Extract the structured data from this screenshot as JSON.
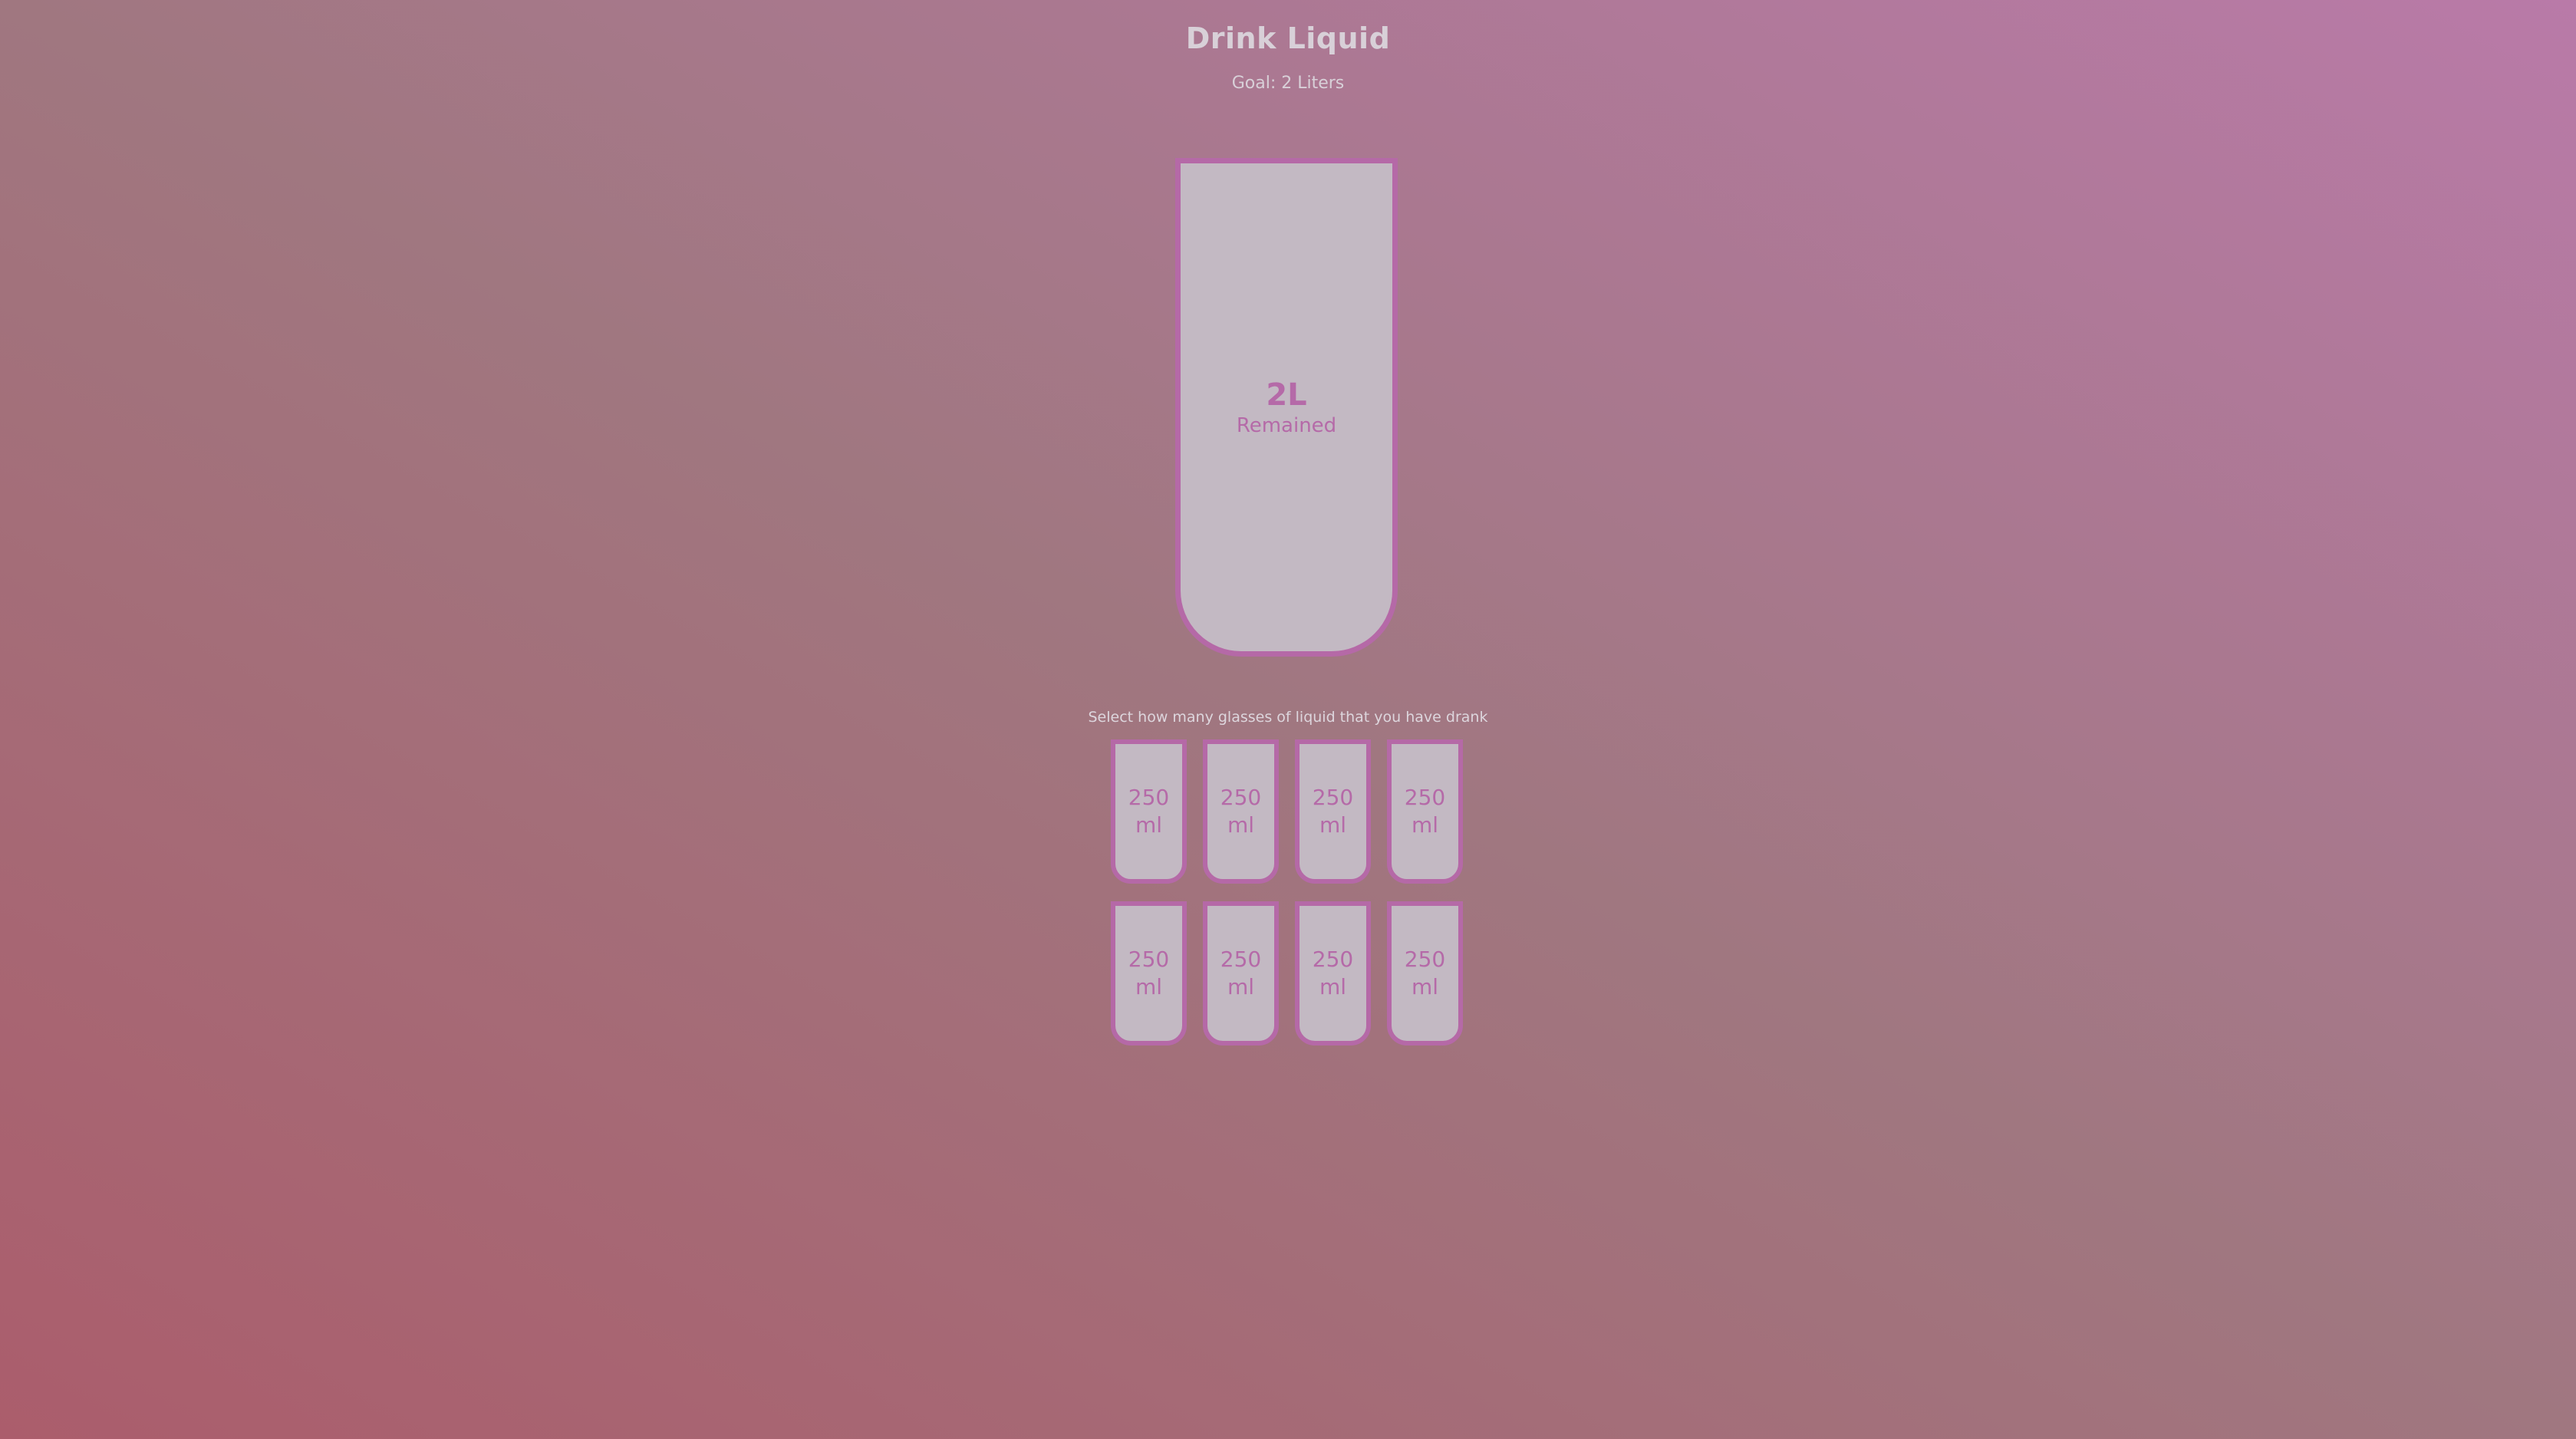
{
  "header": {
    "title": "Drink Liquid",
    "goal": "Goal: 2 Liters"
  },
  "big_cup": {
    "remaining_amount": "2L",
    "remaining_label": "Remained",
    "filled_fraction": 0
  },
  "instruction": "Select how many glasses of liquid that you have drank",
  "small_cups": [
    {
      "label": "250 ml",
      "filled": false
    },
    {
      "label": "250 ml",
      "filled": false
    },
    {
      "label": "250 ml",
      "filled": false
    },
    {
      "label": "250 ml",
      "filled": false
    },
    {
      "label": "250 ml",
      "filled": false
    },
    {
      "label": "250 ml",
      "filled": false
    },
    {
      "label": "250 ml",
      "filled": false
    },
    {
      "label": "250 ml",
      "filled": false
    }
  ],
  "colors": {
    "accent": "#b569a7",
    "cup_fill": "#c3b9c3"
  }
}
